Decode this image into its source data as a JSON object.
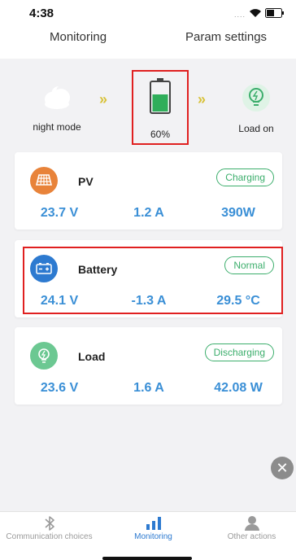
{
  "status": {
    "time": "4:38",
    "signal_dots": "....",
    "icons": [
      "wifi-icon",
      "battery-status-icon"
    ]
  },
  "top_nav": {
    "tabs": [
      {
        "label": "Monitoring"
      },
      {
        "label": "Param settings"
      }
    ]
  },
  "flow": {
    "night_mode": {
      "label": "night mode",
      "icon": "moon-cloud-icon"
    },
    "battery": {
      "label": "60%",
      "icon": "battery-level-icon",
      "level": 0.6
    },
    "load": {
      "label": "Load on",
      "icon": "lightbulb-icon"
    },
    "arrow_symbol": "»",
    "colors": {
      "arrow": "#d8c23a",
      "battery_fill": "#2fae5a",
      "load_icon": "#3cae6c"
    }
  },
  "cards": {
    "pv": {
      "name": "PV",
      "badge": "Charging",
      "values": [
        "23.7 V",
        "1.2 A",
        "390W"
      ],
      "icon": "solar-panel-icon",
      "icon_color": "#e8833a"
    },
    "battery": {
      "name": "Battery",
      "badge": "Normal",
      "values": [
        "24.1 V",
        "-1.3 A",
        "29.5 °C"
      ],
      "icon": "battery-icon",
      "icon_color": "#2d7ad0"
    },
    "load": {
      "name": "Load",
      "badge": "Discharging",
      "values": [
        "23.6 V",
        "1.6 A",
        "42.08 W"
      ],
      "icon": "lightbulb-icon",
      "icon_color": "#3cae6c"
    }
  },
  "close_button": {
    "symbol": "✕",
    "icon": "close-icon"
  },
  "tab_bar": {
    "items": [
      {
        "label": "Communication choices",
        "icon": "bluetooth-icon"
      },
      {
        "label": "Monitoring",
        "icon": "bar-chart-icon",
        "active": true
      },
      {
        "label": "Other actions",
        "icon": "user-icon"
      }
    ]
  },
  "colors": {
    "value_blue": "#3a8fd6",
    "badge_green": "#3cae6c",
    "highlight_red": "#e02020",
    "active_tab": "#2d7ad0"
  }
}
